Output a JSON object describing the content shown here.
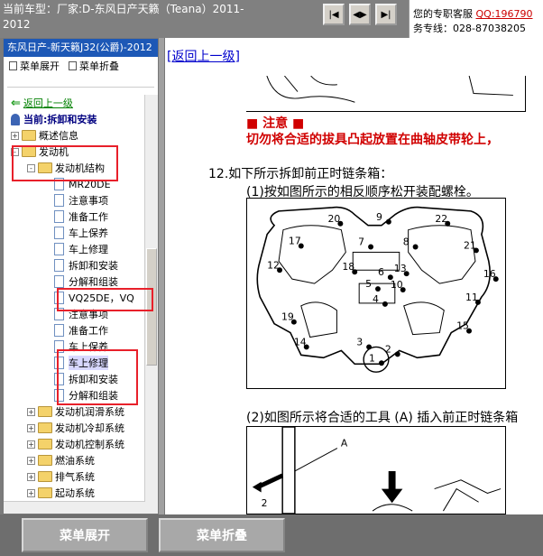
{
  "header": {
    "car_line1": "当前车型：厂家:D-东风日产天籁（Teana）2011-",
    "car_line2": "2012",
    "nav_buttons": [
      "|◀",
      "◀▶",
      "▶|"
    ],
    "service_label": "您的专职客服 ",
    "qq_label": "QQ:196790",
    "hotline": "务专线：028-87038205"
  },
  "left_panel": {
    "title": "东风日产-新天籁J32(公爵)-2012",
    "expand_label": "菜单展开",
    "collapse_label": "菜单折叠",
    "back_label": "返回上一级",
    "current_label": "当前:拆卸和安装",
    "tree": [
      {
        "label": "概述信息",
        "type": "folder",
        "level": 0,
        "toggle": "+"
      },
      {
        "label": "发动机",
        "type": "folder",
        "level": 0,
        "toggle": "-"
      },
      {
        "label": "发动机结构",
        "type": "folder",
        "level": 1,
        "toggle": "-"
      },
      {
        "label": "MR20DE",
        "type": "doc",
        "level": 2
      },
      {
        "label": "注意事项",
        "type": "doc",
        "level": 2
      },
      {
        "label": "准备工作",
        "type": "doc",
        "level": 2
      },
      {
        "label": "车上保养",
        "type": "doc",
        "level": 2
      },
      {
        "label": "车上修理",
        "type": "doc",
        "level": 2
      },
      {
        "label": "拆卸和安装",
        "type": "doc",
        "level": 2
      },
      {
        "label": "分解和组装",
        "type": "doc",
        "level": 2
      },
      {
        "label": "VQ25DE，VQ",
        "type": "doc",
        "level": 2
      },
      {
        "label": "注意事项",
        "type": "doc",
        "level": 2
      },
      {
        "label": "准备工作",
        "type": "doc",
        "level": 2
      },
      {
        "label": "车上保养",
        "type": "doc",
        "level": 2
      },
      {
        "label": "车上修理",
        "type": "doc",
        "level": 2,
        "selected": true
      },
      {
        "label": "拆卸和安装",
        "type": "doc",
        "level": 2
      },
      {
        "label": "分解和组装",
        "type": "doc",
        "level": 2
      },
      {
        "label": "发动机润滑系统",
        "type": "folder",
        "level": 1,
        "toggle": "+"
      },
      {
        "label": "发动机冷却系统",
        "type": "folder",
        "level": 1,
        "toggle": "+"
      },
      {
        "label": "发动机控制系统",
        "type": "folder",
        "level": 1,
        "toggle": "+"
      },
      {
        "label": "燃油系统",
        "type": "folder",
        "level": 1,
        "toggle": "+"
      },
      {
        "label": "排气系统",
        "type": "folder",
        "level": 1,
        "toggle": "+"
      },
      {
        "label": "起动系统",
        "type": "folder",
        "level": 1,
        "toggle": "+"
      },
      {
        "label": "加速控制系统",
        "type": "folder",
        "level": 1,
        "toggle": "+"
      }
    ]
  },
  "content": {
    "back_link": "[返回上一级]",
    "caution_title": "■ 注意 ■",
    "caution_text": "切勿将合适的拔具凸起放置在曲轴皮带轮上，",
    "step12": "12.如下所示拆卸前正时链条箱：",
    "step12_1": "(1)按如图所示的相反顺序松开装配螺栓。",
    "step12_2": "(2)如图所示将合适的工具 (A) 插入前正时链条箱",
    "bolt_numbers": [
      "20",
      "9",
      "22",
      "17",
      "7",
      "8",
      "21",
      "12",
      "18",
      "13",
      "6",
      "10",
      "5",
      "16",
      "4",
      "11",
      "19",
      "15",
      "14",
      "2",
      "1",
      "3"
    ],
    "diagram2_labels": [
      "A",
      "2"
    ]
  },
  "footer": {
    "expand_label": "菜单展开",
    "collapse_label": "菜单折叠"
  },
  "colors": {
    "title_bar": "#1d58b6",
    "caution": "#d00000",
    "highlight_box": "#e8202a"
  }
}
